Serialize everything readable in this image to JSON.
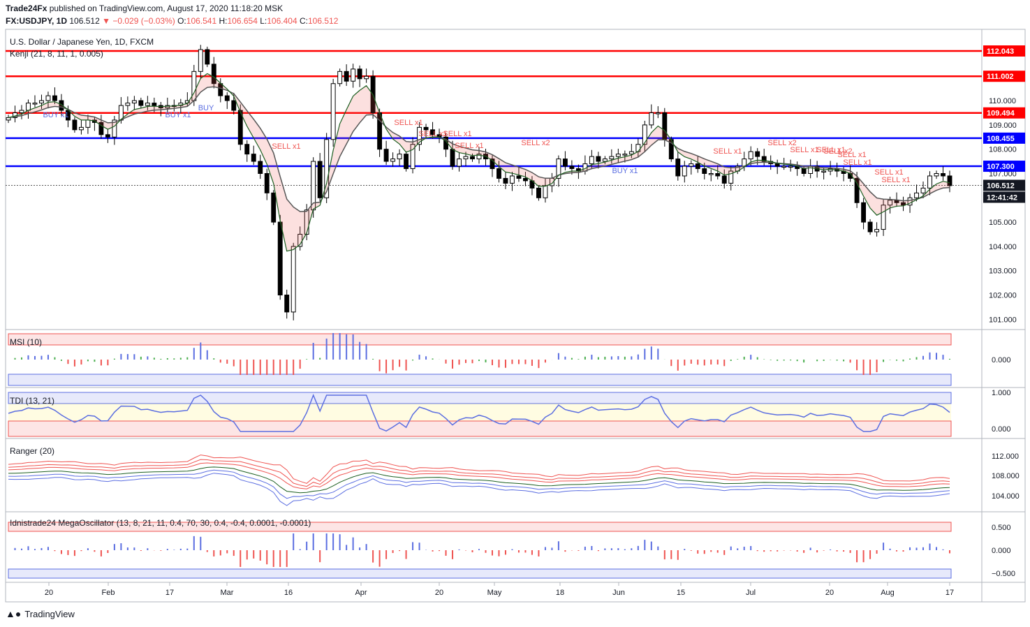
{
  "header": {
    "publisher": "Trade24Fx",
    "published_text": "published on TradingView.com, August 17, 2020 11:18:20 MSK",
    "symbol": "FX:USDJPY, 1D",
    "last": "106.512",
    "change": "−0.029 (−0.03%)",
    "o_label": "O:",
    "o": "106.541",
    "h_label": "H:",
    "h": "106.654",
    "l_label": "L:",
    "l": "106.404",
    "c_label": "C:",
    "c": "106.512"
  },
  "brand": {
    "name": "TradingView"
  },
  "colors": {
    "up": "#26a69a",
    "down": "#ef5350",
    "red_level": "#ff0000",
    "blue_level": "#0000ff",
    "buy": "#5b6ee1",
    "sell": "#ef5350"
  },
  "chart_data": [
    {
      "type": "candlestick",
      "title": "U.S. Dollar / Japanese Yen, 1D, FXCM",
      "indicator_label": "Kenji (21, 8, 11, 1, 0.005)",
      "y_ticks": [
        "112.000",
        "111.000",
        "110.000",
        "109.000",
        "108.000",
        "107.000",
        "106.000",
        "105.000",
        "104.000",
        "103.000",
        "102.000",
        "101.000"
      ],
      "ylim": [
        100.5,
        112.5
      ],
      "x_ticks": [
        "20",
        "Feb",
        "17",
        "Mar",
        "16",
        "Apr",
        "20",
        "May",
        "18",
        "Jun",
        "15",
        "Jul",
        "20",
        "Aug",
        "17"
      ],
      "horizontal_levels": [
        {
          "value": 112.043,
          "label": "112.043",
          "color": "red"
        },
        {
          "value": 111.002,
          "label": "111.002",
          "color": "red"
        },
        {
          "value": 109.494,
          "label": "109.494",
          "color": "red"
        },
        {
          "value": 108.455,
          "label": "108.455",
          "color": "blue"
        },
        {
          "value": 107.3,
          "label": "107.300",
          "color": "blue"
        }
      ],
      "last_price": {
        "value": 106.512,
        "label": "106.512",
        "countdown": "12:41:42"
      },
      "signals": [
        "BUY x1",
        "BUY x1",
        "BUY",
        "SELL x1",
        "SELL x1",
        "SELL x1",
        "SELL x1",
        "SELL x1",
        "SELL x2",
        "BUY x1",
        "SELL x1",
        "SELL x2",
        "SELL x1",
        "SELL x1",
        "SELL x2",
        "SELL x1",
        "SELL x1",
        "SELL x1",
        "SELL x1"
      ],
      "close_series": [
        109.3,
        109.5,
        109.6,
        109.9,
        109.9,
        110.0,
        110.2,
        110.0,
        109.6,
        109.2,
        108.8,
        108.9,
        109.2,
        109.1,
        108.6,
        108.5,
        109.2,
        109.8,
        109.9,
        110.0,
        109.8,
        109.9,
        109.8,
        109.7,
        109.8,
        109.8,
        109.9,
        110.0,
        111.2,
        112.1,
        111.5,
        110.7,
        110.2,
        110.0,
        109.6,
        108.2,
        107.8,
        107.5,
        107.0,
        106.2,
        105.0,
        102.0,
        101.3,
        104.0,
        104.5,
        105.5,
        107.5,
        106.0,
        108.4,
        110.7,
        111.2,
        110.8,
        111.3,
        110.9,
        111.0,
        109.5,
        108.0,
        107.5,
        107.6,
        107.8,
        107.2,
        108.2,
        108.9,
        108.8,
        108.6,
        108.5,
        108.0,
        107.3,
        107.6,
        107.7,
        107.6,
        107.8,
        107.6,
        107.2,
        106.8,
        106.6,
        106.9,
        106.8,
        106.7,
        106.4,
        106.0,
        106.5,
        106.8,
        107.6,
        107.3,
        107.2,
        107.1,
        107.4,
        107.7,
        107.5,
        107.6,
        107.7,
        107.8,
        107.8,
        107.9,
        108.2,
        109.0,
        109.5,
        109.5,
        108.4,
        107.6,
        106.9,
        107.3,
        107.4,
        107.2,
        107.0,
        107.0,
        106.9,
        106.6,
        107.1,
        107.3,
        107.6,
        107.9,
        107.7,
        107.5,
        107.4,
        107.3,
        107.3,
        107.3,
        107.2,
        107.0,
        107.3,
        107.1,
        107.1,
        107.2,
        107.1,
        107.0,
        106.8,
        105.8,
        105.0,
        104.6,
        104.7,
        105.7,
        105.9,
        105.8,
        105.7,
        106.0,
        106.2,
        106.4,
        106.9,
        107.0,
        106.9,
        106.5
      ],
      "oscillators": [
        {
          "label": "MSI (10)",
          "ticks": [
            "0.000"
          ]
        },
        {
          "label": "TDI (13, 21)",
          "ticks": [
            "1.000",
            "0.000"
          ]
        },
        {
          "label": "Ranger (20)",
          "ticks": [
            "112.000",
            "108.000",
            "104.000"
          ]
        },
        {
          "label": "Idnistrade24 MegaOscillator (13, 8, 21, 11, 0.4, 70, 30, 0.4, -0.4, 0.0001, -0.0001)",
          "ticks": [
            "0.500",
            "0.000",
            "−0.500"
          ]
        }
      ]
    }
  ]
}
